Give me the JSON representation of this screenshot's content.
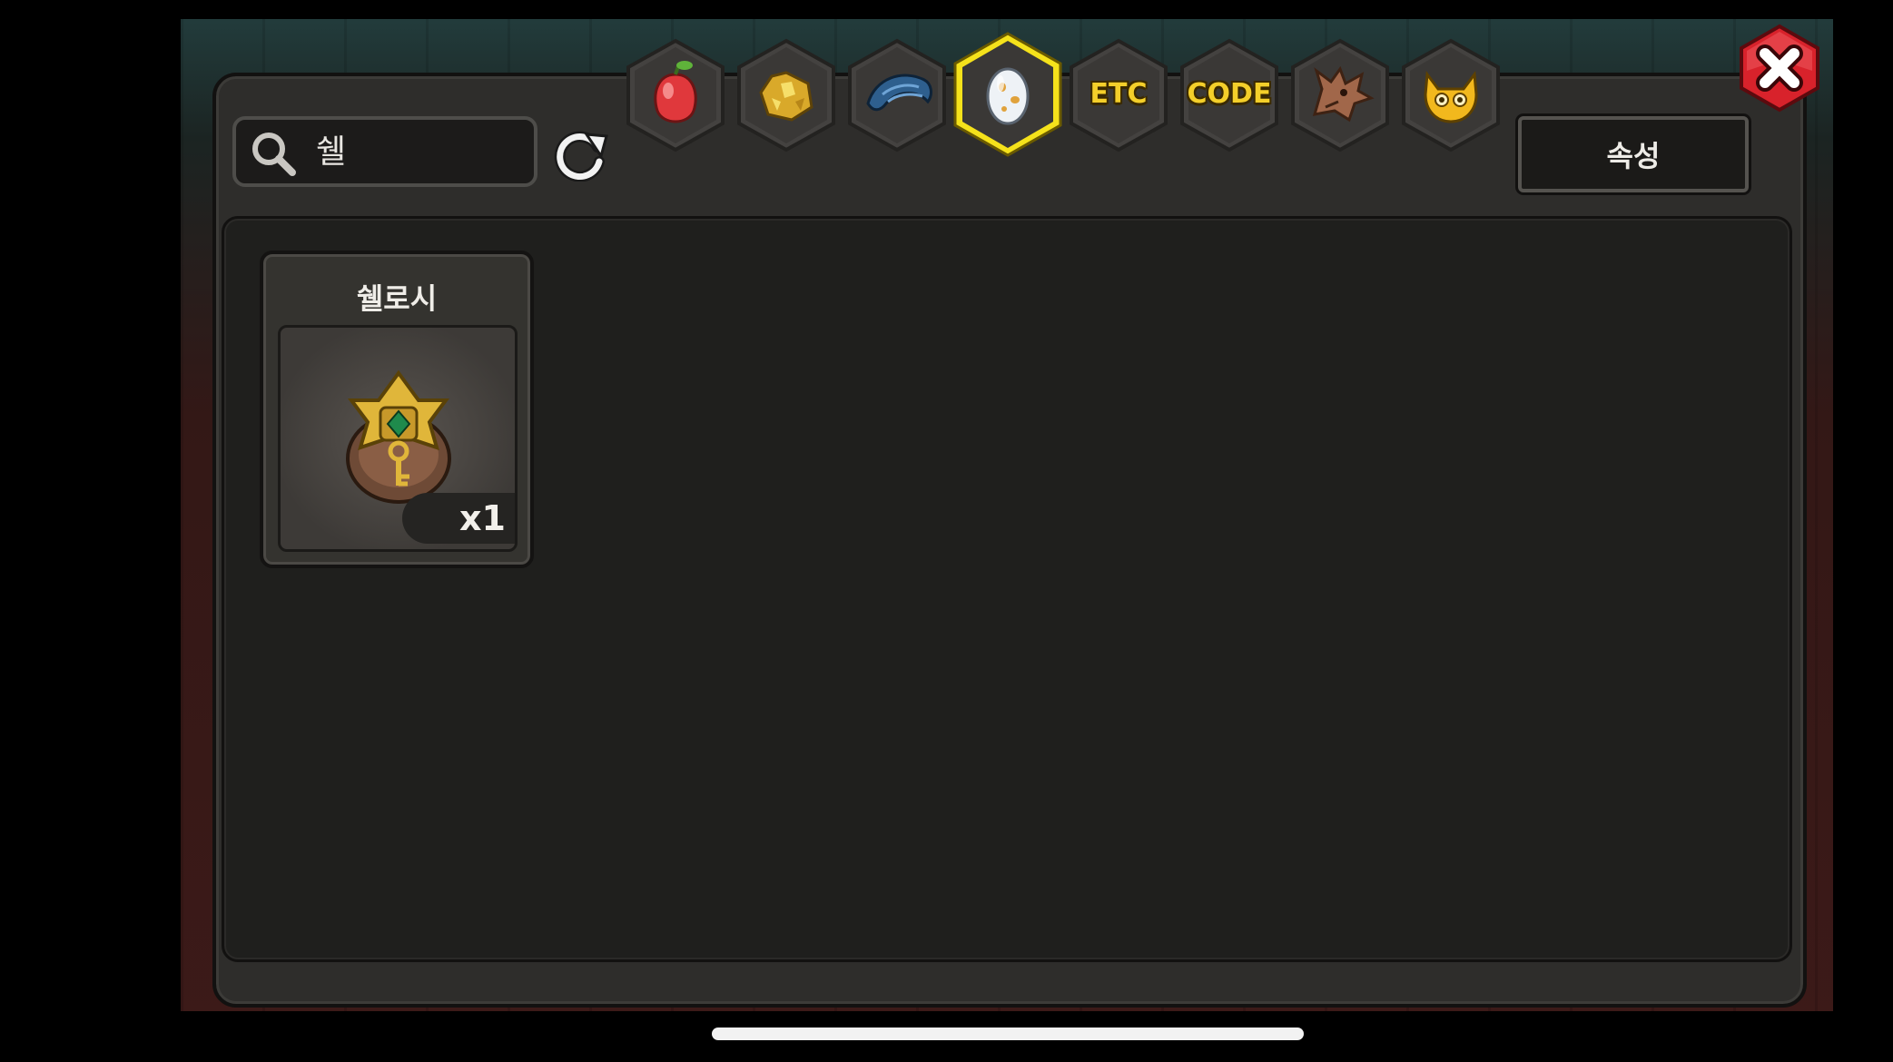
{
  "search": {
    "value": "쉘"
  },
  "tabs": [
    {
      "name": "fruit-tab",
      "label": "",
      "icon": "fruit-icon",
      "selected": false
    },
    {
      "name": "ore-tab",
      "label": "",
      "icon": "gold-ore-icon",
      "selected": false
    },
    {
      "name": "scale-tab",
      "label": "",
      "icon": "dragon-scale-icon",
      "selected": false
    },
    {
      "name": "egg-tab",
      "label": "",
      "icon": "egg-icon",
      "selected": true
    },
    {
      "name": "etc-tab",
      "label": "ETC",
      "icon": "",
      "selected": false
    },
    {
      "name": "code-tab",
      "label": "CODE",
      "icon": "",
      "selected": false
    },
    {
      "name": "dragon-tab",
      "label": "",
      "icon": "dragon-head-icon",
      "selected": false
    },
    {
      "name": "pet-tab",
      "label": "",
      "icon": "horned-pet-icon",
      "selected": false
    }
  ],
  "attribute_button": {
    "label": "속성"
  },
  "items": [
    {
      "name": "쉘로시",
      "count": "x1",
      "icon": "shell-key-icon"
    }
  ],
  "colors": {
    "panel": "#2e2d2b",
    "content": "#1f1f1d",
    "tab_selected_border": "#f5e21b",
    "tab_label": "#f4cf2a",
    "close_red": "#d8222b"
  }
}
